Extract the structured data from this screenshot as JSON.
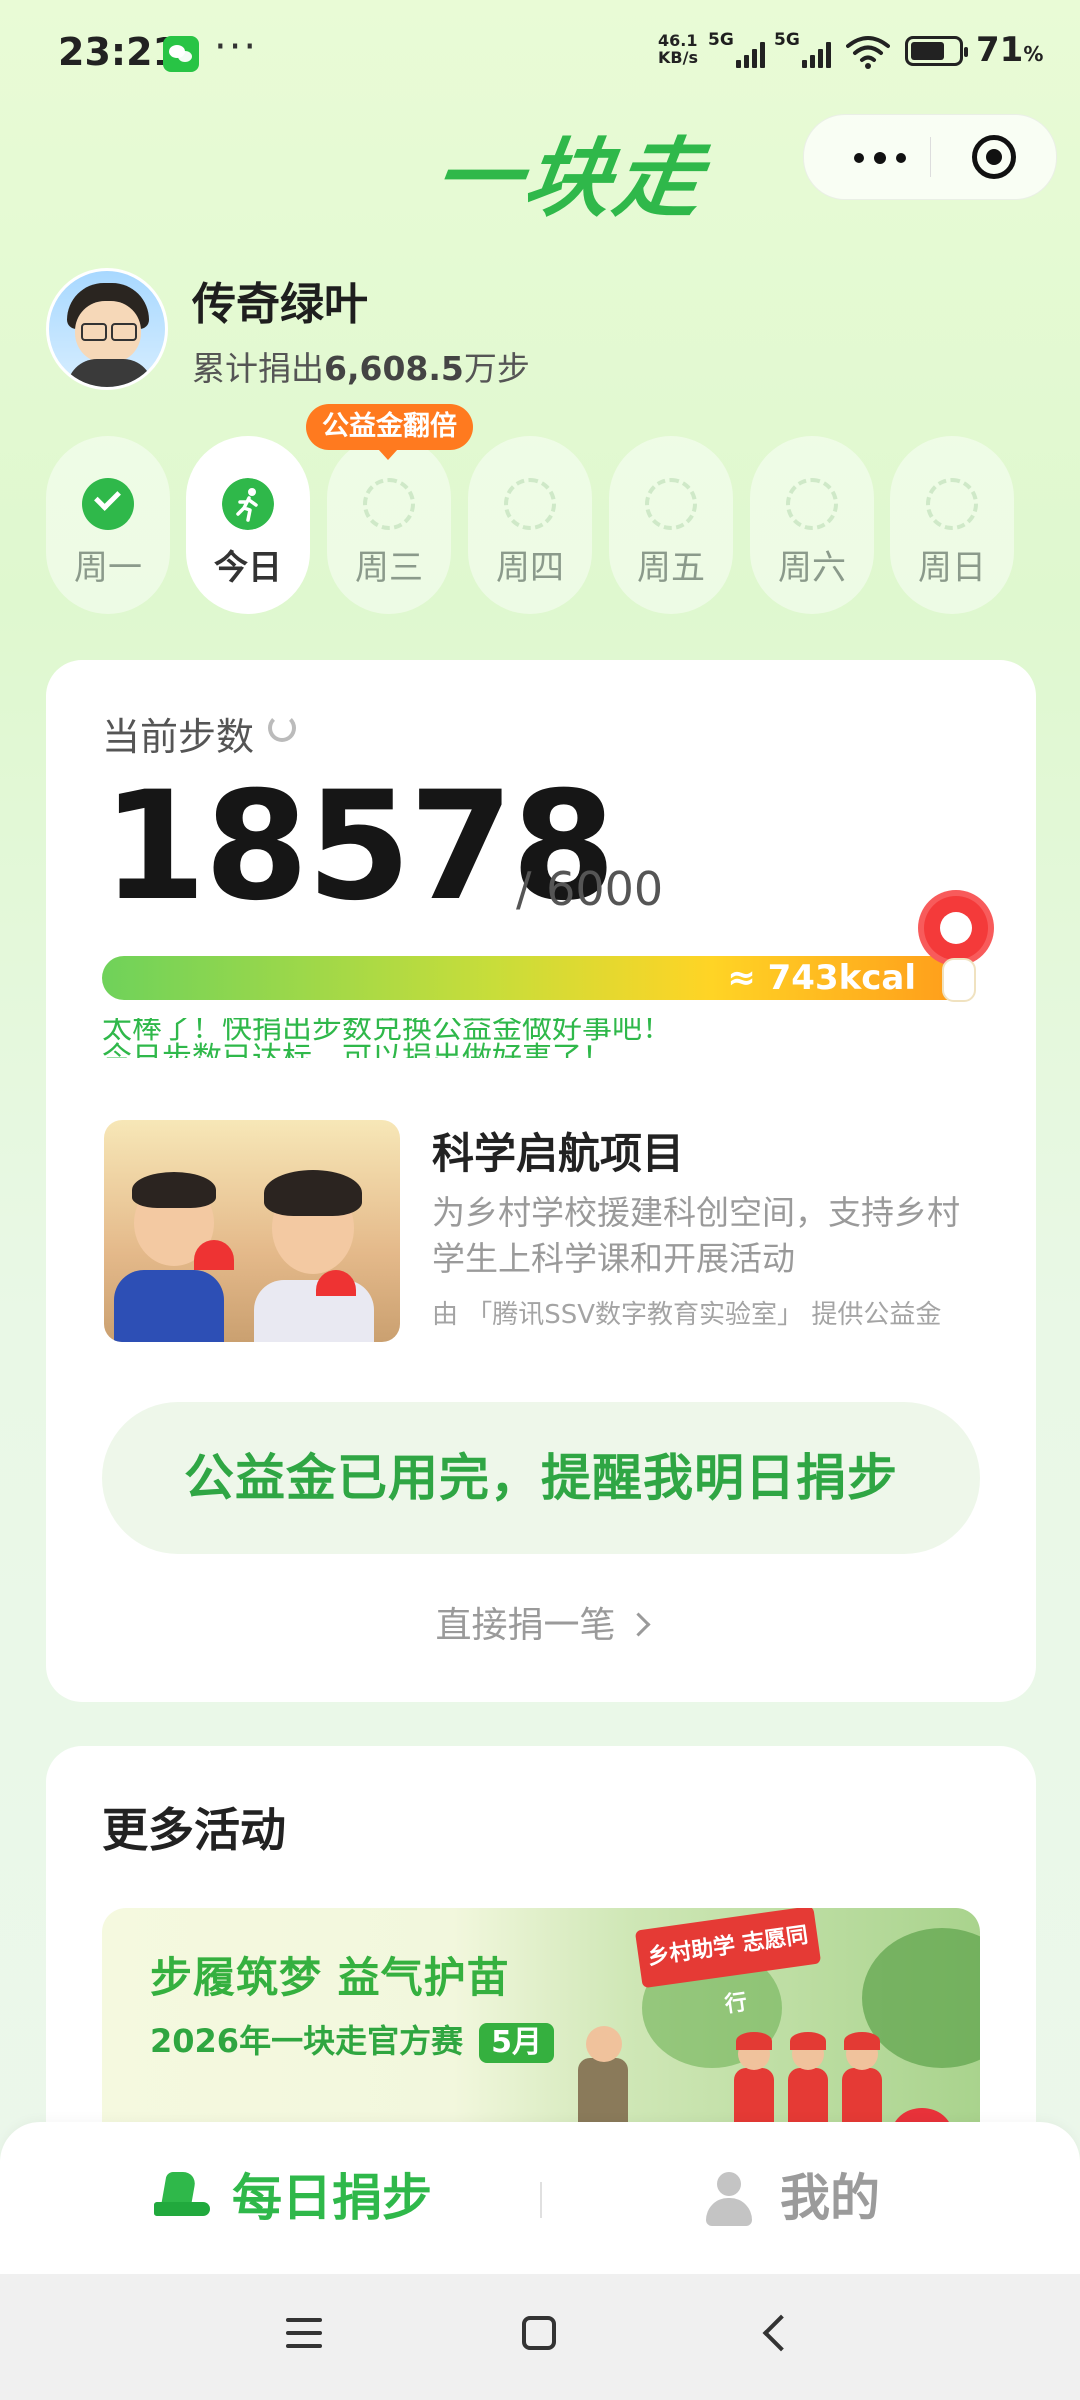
{
  "status_bar": {
    "time": "23:21",
    "more": "···",
    "net_speed_value": "46.1",
    "net_speed_unit": "KB/s",
    "sim1": "5G",
    "sim2": "5G",
    "battery_percent_value": "71",
    "battery_percent_symbol": "%",
    "battery_level": 0.71
  },
  "header": {
    "app_title": "一块走"
  },
  "profile": {
    "name": "传奇绿叶",
    "cumulative_prefix": "累计捐出",
    "cumulative_value": "6,608.5",
    "cumulative_unit": "万步"
  },
  "week": {
    "bonus_badge": "公益金翻倍",
    "days": [
      {
        "label": "周一",
        "state": "done"
      },
      {
        "label": "今日",
        "state": "today"
      },
      {
        "label": "周三",
        "state": "empty"
      },
      {
        "label": "周四",
        "state": "empty"
      },
      {
        "label": "周五",
        "state": "empty"
      },
      {
        "label": "周六",
        "state": "empty"
      },
      {
        "label": "周日",
        "state": "empty"
      }
    ]
  },
  "steps_card": {
    "title": "当前步数",
    "steps": "18578",
    "goal": "/ 6000",
    "calories": "≈ 743kcal",
    "ticker_line1": "太棒了！快捐出步数兑换公益金做好事吧！",
    "ticker_line2": "今日步数已达标，可以捐出做好事了！"
  },
  "project": {
    "title": "科学启航项目",
    "description": "为乡村学校援建科创空间，支持乡村学生上科学课和开展活动",
    "sponsor": "由 「腾讯SSV数字教育实验室」 提供公益金"
  },
  "actions": {
    "primary_button": "公益金已用完，提醒我明日捐步",
    "direct_donate": "直接捐一笔"
  },
  "activities": {
    "title": "更多活动",
    "banner_title": "步履筑梦 益气护苗",
    "banner_subtitle": "2026年一块走官方赛",
    "banner_tag": "5月",
    "banner_flag": "乡村助学 志愿同行"
  },
  "tabbar": {
    "daily": "每日捐步",
    "mine": "我的"
  },
  "colors": {
    "brand_green": "#2fb84a",
    "accent_orange": "#ff7a1f"
  }
}
